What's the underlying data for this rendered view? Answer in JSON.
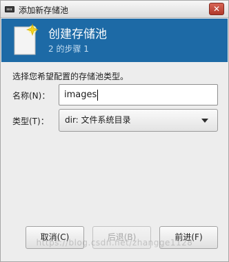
{
  "window": {
    "title": "添加新存储池",
    "close_label": "✕"
  },
  "header": {
    "title": "创建存储池",
    "step": "2 的步骤 1"
  },
  "instruction": "选择您希望配置的存储池类型。",
  "form": {
    "name_label": "名称(N)：",
    "name_value": "images",
    "type_label": "类型(T)：",
    "type_value": "dir: 文件系统目录"
  },
  "buttons": {
    "cancel": "取消(C)",
    "back": "后退(B)",
    "forward": "前进(F)"
  },
  "watermark": "https://blog.csdn.net/zhangge1128",
  "colors": {
    "header_bg": "#1d6aa6",
    "window_bg": "#ededed"
  }
}
